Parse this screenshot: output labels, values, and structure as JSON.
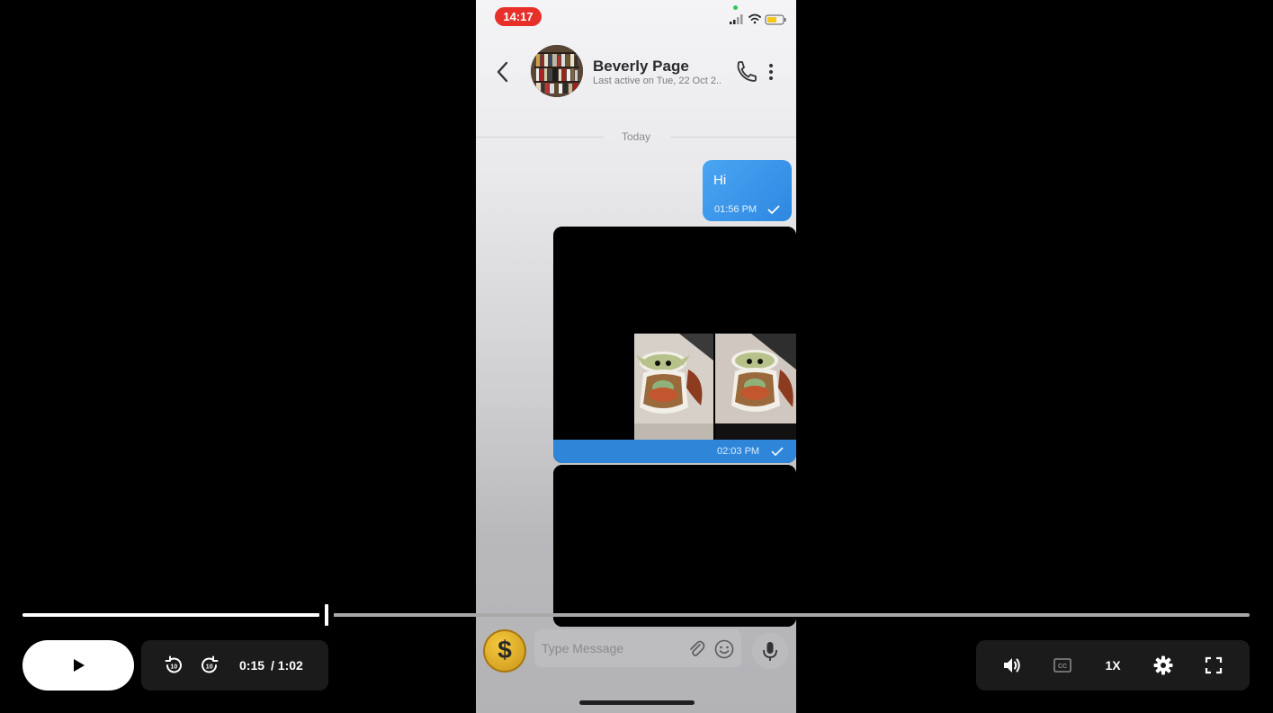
{
  "phone": {
    "status_time": "14:17",
    "contact_name": "Beverly Page",
    "last_active": "Last active on Tue, 22 Oct 2...",
    "date_divider": "Today",
    "messages": [
      {
        "text": "Hi",
        "time": "01:56 PM"
      },
      {
        "time": "02:03 PM"
      }
    ],
    "composer_placeholder": "Type Message",
    "pay_symbol": "$"
  },
  "player": {
    "current_time": "0:15",
    "duration": "/ 1:02",
    "progress": 0.242,
    "speed": "1X"
  },
  "colors": {
    "status_pill": "#e8302b",
    "bubble_blue": "#2d87e2",
    "battery": "#f5c518"
  }
}
